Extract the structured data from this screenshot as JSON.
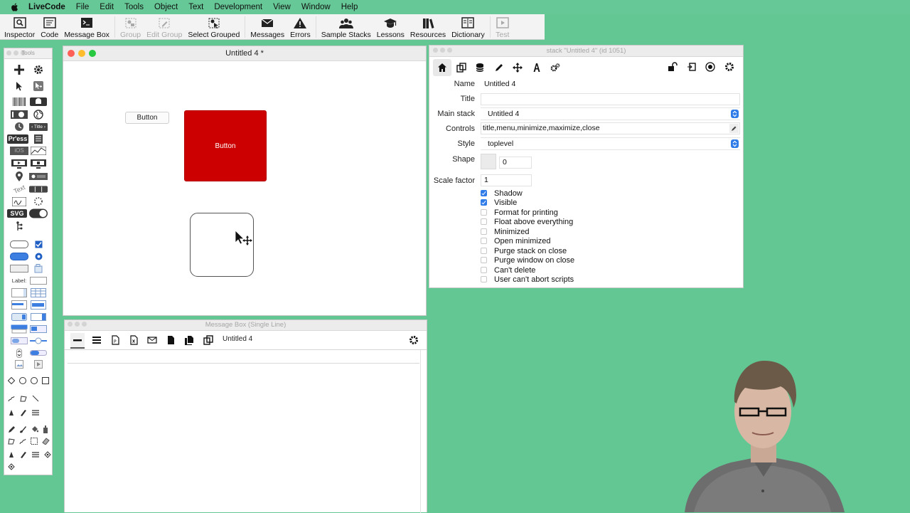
{
  "menubar": {
    "app_name": "LiveCode",
    "items": [
      "File",
      "Edit",
      "Tools",
      "Object",
      "Text",
      "Development",
      "View",
      "Window",
      "Help"
    ]
  },
  "toolbar": {
    "buttons": [
      {
        "label": "Inspector",
        "icon": "inspector-icon",
        "enabled": true
      },
      {
        "label": "Code",
        "icon": "code-icon",
        "enabled": true
      },
      {
        "label": "Message Box",
        "icon": "message-box-icon",
        "enabled": true
      },
      {
        "label": "Group",
        "icon": "group-icon",
        "enabled": false
      },
      {
        "label": "Edit Group",
        "icon": "edit-group-icon",
        "enabled": false
      },
      {
        "label": "Select Grouped",
        "icon": "select-grouped-icon",
        "enabled": true
      },
      {
        "label": "Messages",
        "icon": "messages-icon",
        "enabled": true
      },
      {
        "label": "Errors",
        "icon": "errors-icon",
        "enabled": true
      },
      {
        "label": "Sample Stacks",
        "icon": "sample-stacks-icon",
        "enabled": true
      },
      {
        "label": "Lessons",
        "icon": "lessons-icon",
        "enabled": true
      },
      {
        "label": "Resources",
        "icon": "resources-icon",
        "enabled": true
      },
      {
        "label": "Dictionary",
        "icon": "dictionary-icon",
        "enabled": true
      },
      {
        "label": "Test",
        "icon": "test-icon",
        "enabled": false
      }
    ]
  },
  "tools": {
    "title": "Tools",
    "label_widget": "Label:",
    "svg_widget": "SVG",
    "press_widget": "Pr'ess",
    "title_widget": "‹ Title ›",
    "text_widget": "Text"
  },
  "stack_window": {
    "title": "Untitled 4 *",
    "card_button_label": "Button",
    "red_button_label": "Button"
  },
  "inspector": {
    "title": "stack \"Untitled 4\" (id 1051)",
    "fields": {
      "name_label": "Name",
      "name_value": "Untitled 4",
      "title_label": "Title",
      "title_value": "",
      "mainstack_label": "Main stack",
      "mainstack_value": "Untitled 4",
      "controls_label": "Controls",
      "controls_value": "title,menu,minimize,maximize,close",
      "style_label": "Style",
      "style_value": "toplevel",
      "shape_label": "Shape",
      "shape_value": "0",
      "scale_label": "Scale factor",
      "scale_value": "1"
    },
    "checkboxes": [
      {
        "label": "Shadow",
        "checked": true
      },
      {
        "label": "Visible",
        "checked": true
      },
      {
        "label": "Format for printing",
        "checked": false
      },
      {
        "label": "Float above everything",
        "checked": false
      },
      {
        "label": "Minimized",
        "checked": false
      },
      {
        "label": "Open minimized",
        "checked": false
      },
      {
        "label": "Purge stack on close",
        "checked": false
      },
      {
        "label": "Purge window on close",
        "checked": false
      },
      {
        "label": "Can't delete",
        "checked": false
      },
      {
        "label": "User can't abort scripts",
        "checked": false
      }
    ]
  },
  "message_box": {
    "title": "Message Box (Single Line)",
    "target_stack": "Untitled 4"
  },
  "colors": {
    "desktop": "#63c794",
    "accent_blue": "#2f7ce9",
    "button_red": "#cc0000"
  }
}
